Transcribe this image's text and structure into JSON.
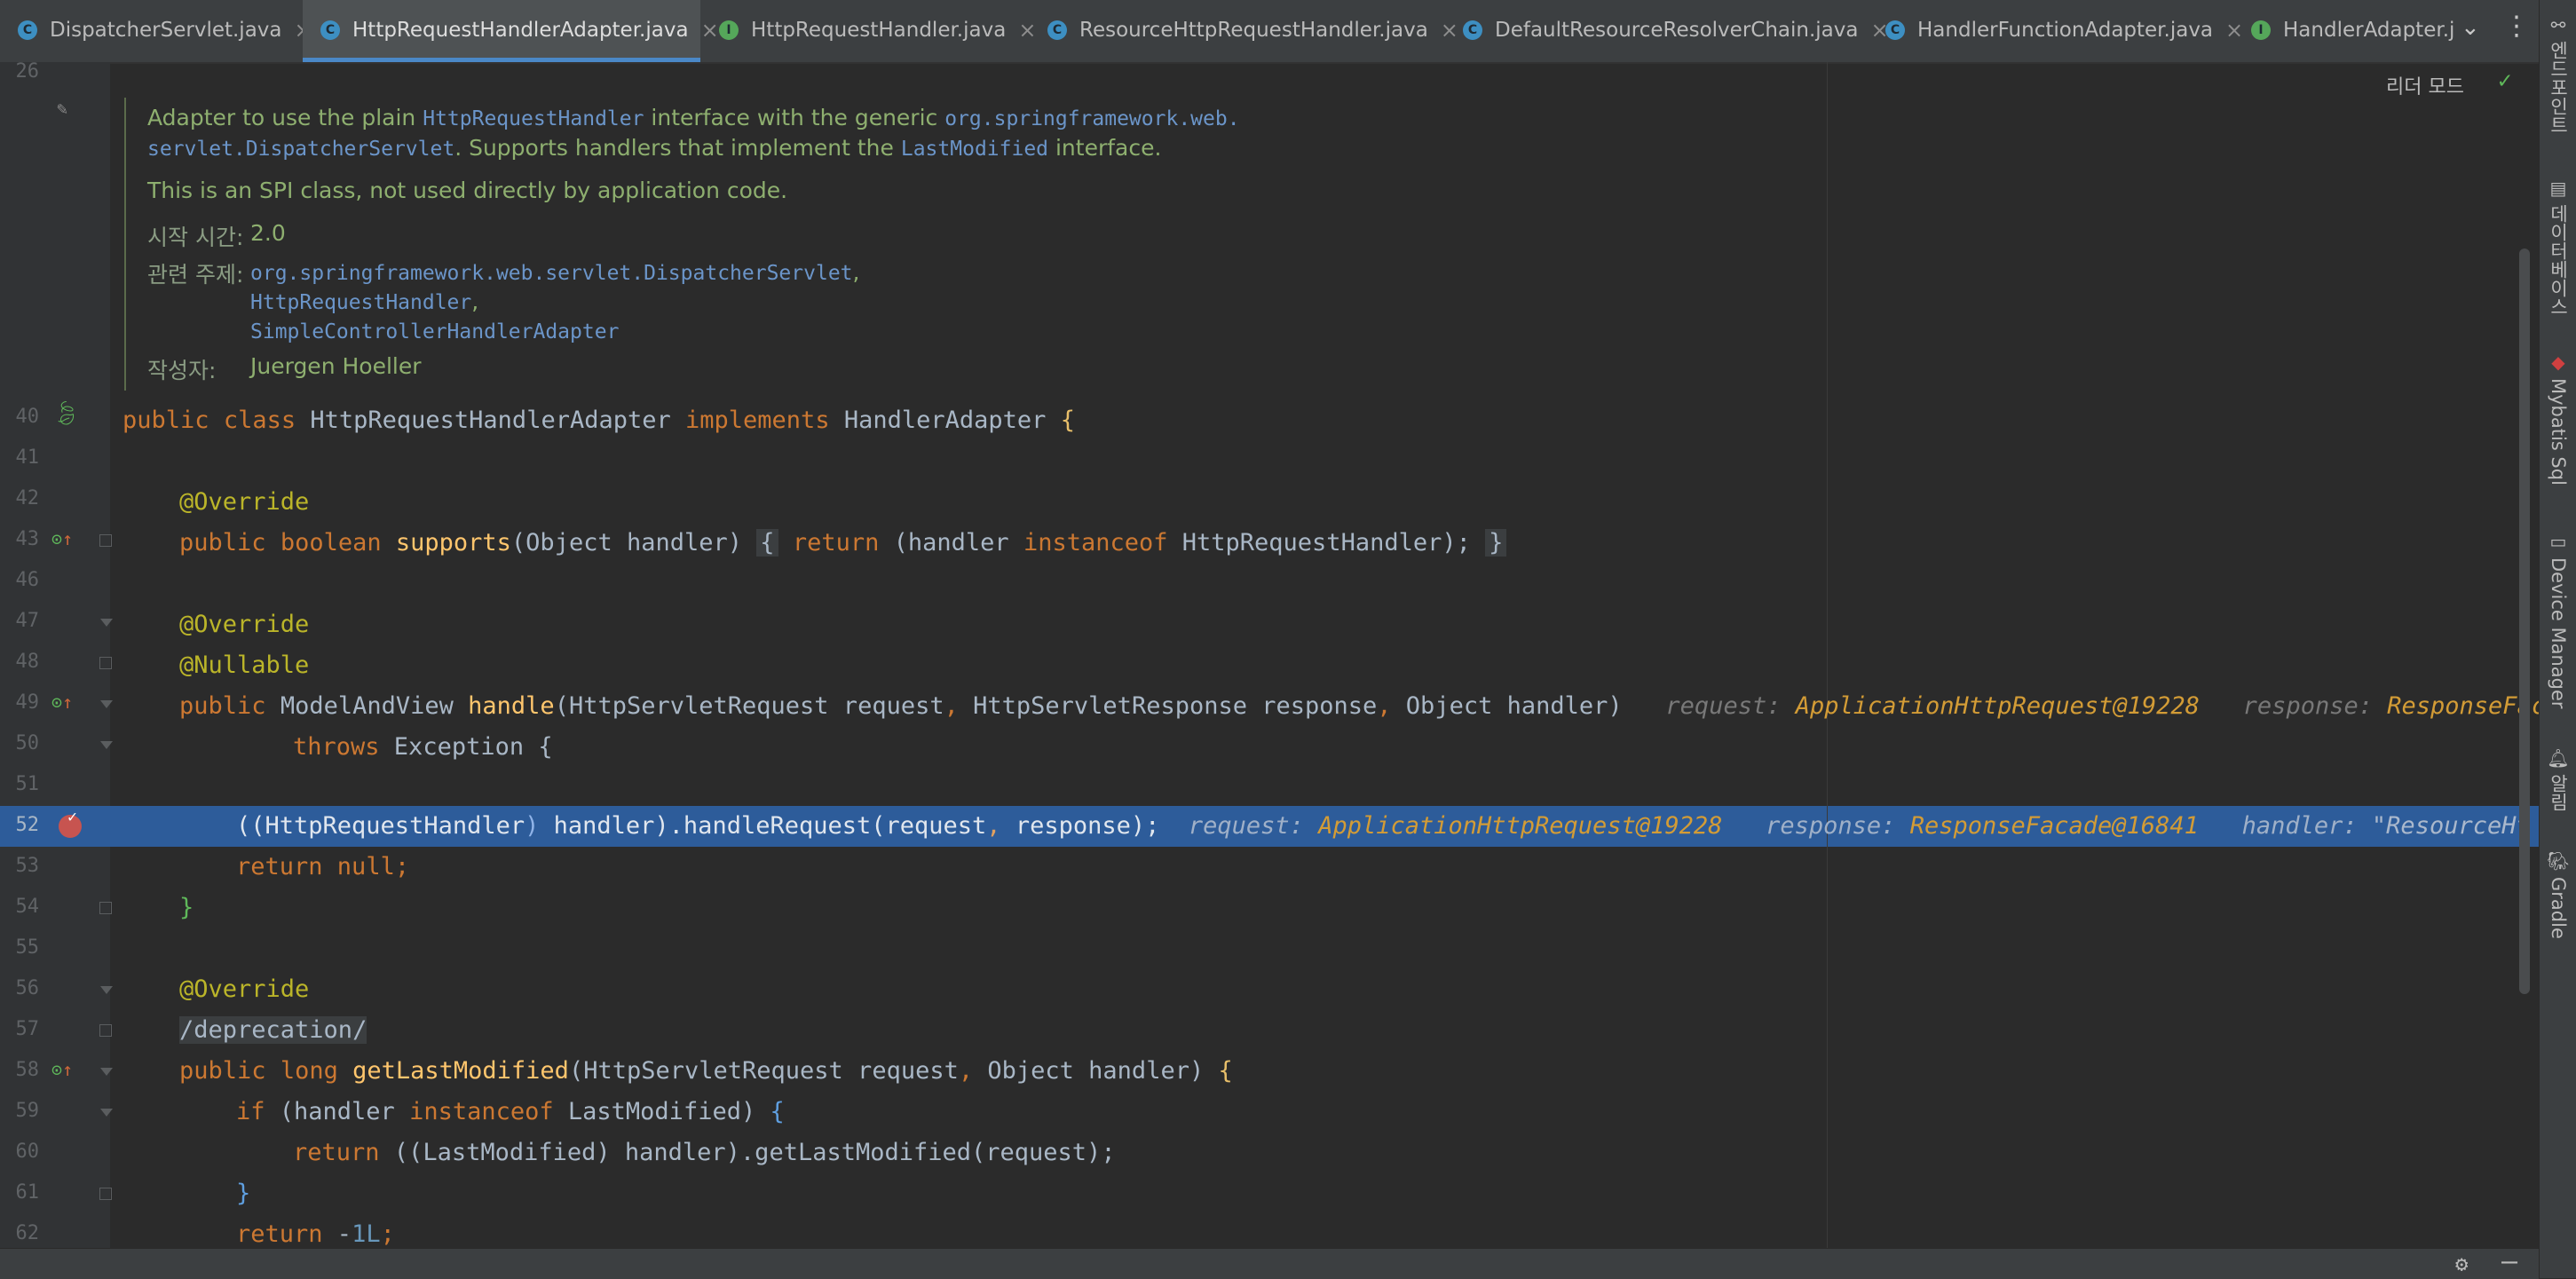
{
  "tabs": [
    {
      "label": "DispatcherServlet.java",
      "kind": "class",
      "active": false,
      "closable": true
    },
    {
      "label": "HttpRequestHandlerAdapter.java",
      "kind": "class",
      "active": true,
      "closable": true
    },
    {
      "label": "HttpRequestHandler.java",
      "kind": "interface",
      "active": false,
      "closable": true
    },
    {
      "label": "ResourceHttpRequestHandler.java",
      "kind": "class",
      "active": false,
      "closable": true
    },
    {
      "label": "DefaultResourceResolverChain.java",
      "kind": "class",
      "active": false,
      "closable": true
    },
    {
      "label": "HandlerFunctionAdapter.java",
      "kind": "class",
      "active": false,
      "closable": true
    },
    {
      "label": "HandlerAdapter.jav",
      "kind": "interface",
      "active": false,
      "closable": false
    }
  ],
  "tab_icons": {
    "class": "C",
    "interface": "I",
    "close": "×",
    "overflow": "⌄",
    "menu": "⋮"
  },
  "right_tools": [
    {
      "label": "엔드포인트",
      "icon": "endpoints-icon"
    },
    {
      "label": "데이터베이스",
      "icon": "database-icon"
    },
    {
      "label": "Mybatis Sql",
      "icon": "mybatis-icon"
    },
    {
      "label": "Device Manager",
      "icon": "device-manager-icon"
    },
    {
      "label": "알림",
      "icon": "notifications-icon"
    },
    {
      "label": "Gradle",
      "icon": "gradle-icon"
    }
  ],
  "reader_mode": "리더 모드",
  "doc": {
    "line1_a": "Adapter to use the plain ",
    "line1_b": "HttpRequestHandler",
    "line1_c": " interface with the generic ",
    "line1_d": "org.springframework.web.",
    "line2_a": "servlet.DispatcherServlet",
    "line2_b": ". Supports handlers that implement the ",
    "line2_c": "LastModified",
    "line2_d": " interface.",
    "line3": "This is an SPI class, not used directly by application code.",
    "since_label": "시작 시간:",
    "since_value": "2.0",
    "see_label": "관련 주제:",
    "see_1": "org.springframework.web.servlet.DispatcherServlet",
    "see_1_sep": ",",
    "see_2": "HttpRequestHandler",
    "see_2_sep": ",",
    "see_3": "SimpleControllerHandlerAdapter",
    "author_label": "작성자:",
    "author_value": "Juergen Hoeller"
  },
  "line_numbers": [
    "26",
    "40",
    "41",
    "42",
    "43",
    "46",
    "47",
    "48",
    "49",
    "50",
    "51",
    "52",
    "53",
    "54",
    "55",
    "56",
    "57",
    "58",
    "59",
    "60",
    "61",
    "62"
  ],
  "code": {
    "l40": {
      "kw1": "public",
      "kw2": "class",
      "name": "HttpRequestHandlerAdapter",
      "kw3": "implements",
      "iface": "HandlerAdapter",
      "brace": "{"
    },
    "l42": "@Override",
    "l43": {
      "kw1": "public",
      "kw2": "boolean",
      "fn": "supports",
      "args": "(Object handler)",
      "open": "{",
      "kw3": "return",
      "body1": "(handler ",
      "kw4": "instanceof",
      "body2": " HttpRequestHandler);",
      "close": "}"
    },
    "l47": "@Override",
    "l48": "@Nullable",
    "l49": {
      "kw1": "public",
      "type": "ModelAndView",
      "fn": "handle",
      "args_a": "(HttpServletRequest request",
      "comma1": ",",
      "args_b": " HttpServletResponse response",
      "comma2": ",",
      "args_c": " Object handler)",
      "hint1_k": "request:",
      "hint1_v": "ApplicationHttpRequest@19228",
      "hint2_k": "response:",
      "hint2_v": "ResponseFaca"
    },
    "l50": {
      "kw": "throws",
      "rest": " Exception {"
    },
    "l52": {
      "code_a": "((HttpRequestHandler",
      ")": ")",
      "code_b": " handler).handleRequest(request",
      ",": ",",
      "code_c": " response);",
      "hint1_k": "request:",
      "hint1_v": "ApplicationHttpRequest@19228",
      "hint2_k": "response:",
      "hint2_v": "ResponseFacade@16841",
      "hint3_k": "handler:",
      "hint3_v": "\"ResourceHt"
    },
    "l53": {
      "kw": "return",
      "rest": " null;"
    },
    "l54": "}",
    "l56": "@Override",
    "l57": "/deprecation/",
    "l58": {
      "kw1": "public",
      "kw2": "long",
      "fn": "getLastModified",
      "args_a": "(HttpServletRequest request",
      ",": ",",
      "args_b": " Object handler)",
      "brace": "{"
    },
    "l59": {
      "kw1": "if",
      "a": " (handler ",
      "kw2": "instanceof",
      "b": " LastModified)",
      "brace": "{"
    },
    "l60": {
      "kw": "return",
      "rest": " ((LastModified) handler).getLastModified(request);"
    },
    "l61": "}",
    "l62": {
      "kw": "return",
      "minus": " -",
      "num": "1L",
      ";": ";"
    }
  },
  "colors": {
    "background": "#2b2b2b",
    "keyword": "#cc7832",
    "annotation": "#bbb529",
    "method": "#ffc66d",
    "number": "#6897bb",
    "doc_text": "#8eaf6f",
    "doc_link": "#6b95c9",
    "execution_line": "#2d5c9a",
    "breakpoint": "#c75450"
  }
}
